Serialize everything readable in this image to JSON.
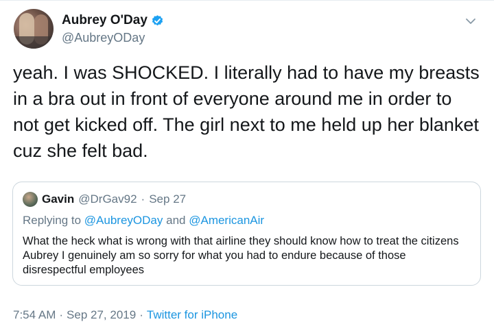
{
  "author": {
    "display_name": "Aubrey O'Day",
    "handle": "@AubreyODay",
    "verified": true,
    "icon": "verified-badge-icon"
  },
  "tweet": {
    "text": "yeah. I was SHOCKED. I literally had to have my breasts in a bra out in front of everyone around me in order to not get kicked off. The girl next to me held up her blanket cuz she felt bad."
  },
  "quoted": {
    "name": "Gavin",
    "handle": "@DrGav92",
    "separator": "·",
    "date": "Sep 27",
    "reply_prefix": "Replying to",
    "reply_mention_1": "@AubreyODay",
    "reply_and": "and",
    "reply_mention_2": "@AmericanAir",
    "text": "What the heck what is wrong with that airline they should know how to treat the citizens Aubrey I genuinely am so sorry for what you had to endure because of those disrespectful employees"
  },
  "meta": {
    "time": "7:54 AM",
    "separator1": "·",
    "date": "Sep 27, 2019",
    "separator2": "·",
    "source": "Twitter for iPhone"
  },
  "colors": {
    "link": "#1b95e0",
    "secondary_text": "#657786",
    "primary_text": "#14171a",
    "border": "#ccd6dd"
  }
}
